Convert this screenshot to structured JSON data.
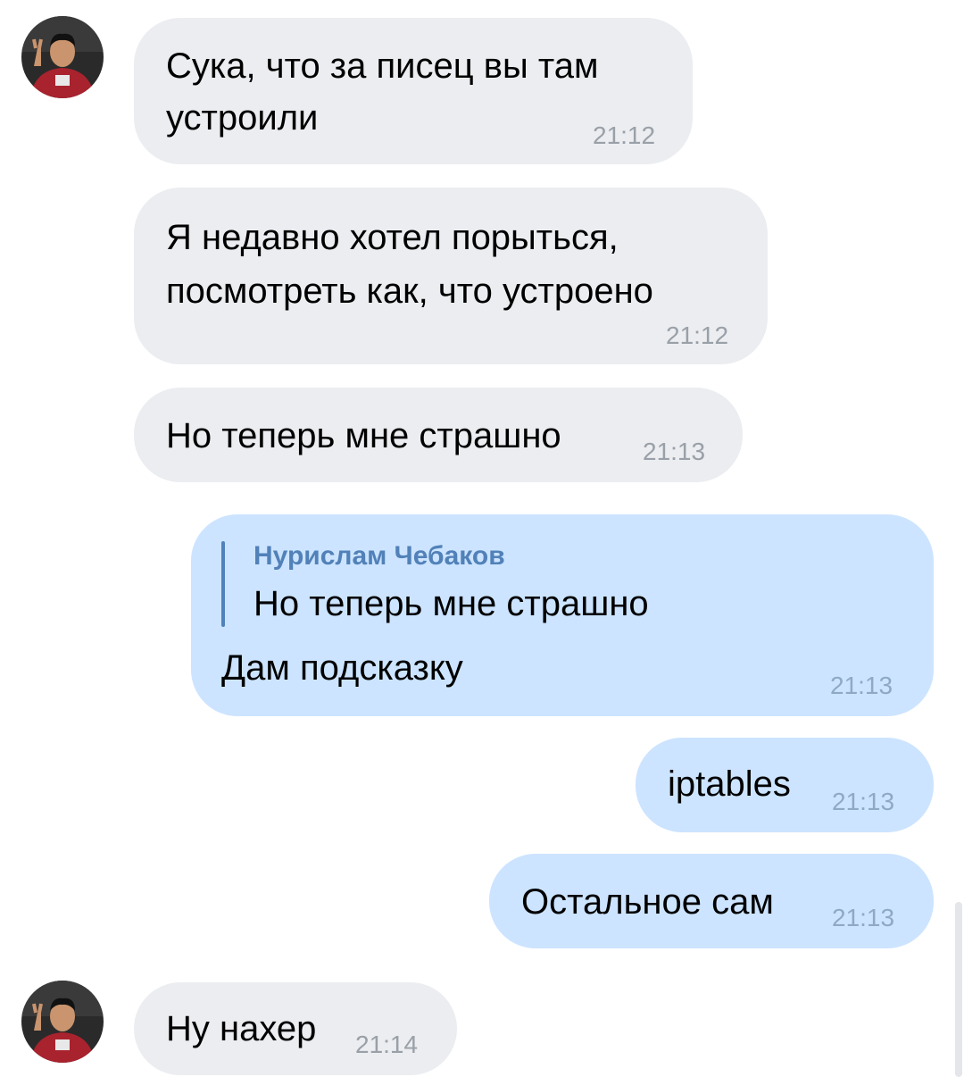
{
  "contact": {
    "name": "Нурислам Чебаков",
    "avatar_icon": "user-photo-avatar"
  },
  "colors": {
    "incoming_bubble": "#ebedf0",
    "outgoing_bubble": "#cce4ff",
    "reply_accent": "#5181b8",
    "timestamp": "#9aa0a8"
  },
  "messages": [
    {
      "direction": "incoming",
      "lines": [
        "Сука, что за писец вы там",
        "устроили"
      ],
      "time": "21:12"
    },
    {
      "direction": "incoming",
      "lines": [
        "Я недавно хотел порыться,",
        "посмотреть как, что устроено"
      ],
      "time": "21:12"
    },
    {
      "direction": "incoming",
      "lines": [
        "Но теперь мне страшно"
      ],
      "time": "21:13"
    },
    {
      "direction": "outgoing",
      "reply": {
        "author": "Нурислам Чебаков",
        "text": "Но теперь мне страшно"
      },
      "lines": [
        "Дам подсказку"
      ],
      "time": "21:13"
    },
    {
      "direction": "outgoing",
      "lines": [
        "iptables"
      ],
      "time": "21:13"
    },
    {
      "direction": "outgoing",
      "lines": [
        "Остальное сам"
      ],
      "time": "21:13"
    },
    {
      "direction": "incoming",
      "lines": [
        "Ну нахер"
      ],
      "time": "21:14"
    }
  ]
}
